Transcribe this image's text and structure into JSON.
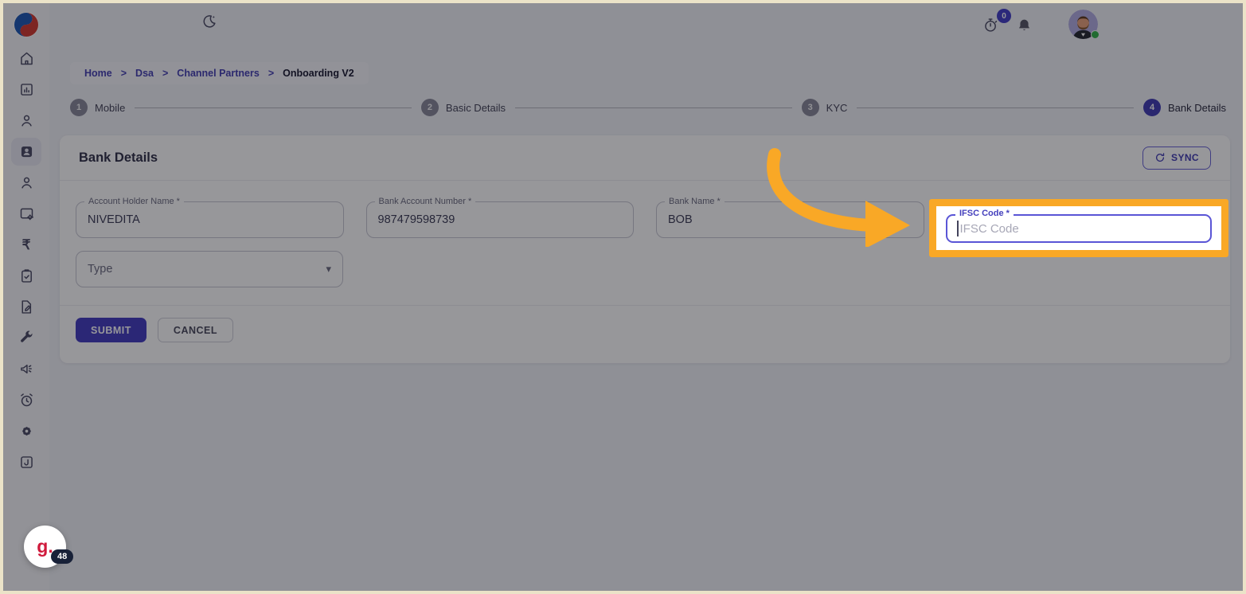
{
  "topbar": {
    "timer_badge": "0"
  },
  "breadcrumb": {
    "separator": ">",
    "items": [
      "Home",
      "Dsa",
      "Channel Partners"
    ],
    "current": "Onboarding V2"
  },
  "stepper": {
    "active_step": "4",
    "steps": [
      {
        "number": "1",
        "label": "Mobile"
      },
      {
        "number": "2",
        "label": "Basic Details"
      },
      {
        "number": "3",
        "label": "KYC"
      },
      {
        "number": "4",
        "label": "Bank Details"
      }
    ]
  },
  "card": {
    "title": "Bank Details",
    "sync_label": "SYNC"
  },
  "form": {
    "account_holder": {
      "label": "Account Holder Name *",
      "value": "NIVEDITA"
    },
    "account_number": {
      "label": "Bank Account Number *",
      "value": "987479598739"
    },
    "bank_name": {
      "label": "Bank Name *",
      "value": "BOB"
    },
    "ifsc": {
      "label": "IFSC Code *",
      "placeholder": "IFSC Code",
      "value": ""
    },
    "type": {
      "placeholder": "Type"
    },
    "submit_label": "SUBMIT",
    "cancel_label": "CANCEL"
  },
  "sidebar": {
    "icons": [
      "home",
      "dashboard",
      "user",
      "id-card",
      "user-group",
      "window-settings",
      "rupee",
      "clipboard-check",
      "file-edit",
      "wrench",
      "megaphone",
      "alarm",
      "settings",
      "journal"
    ],
    "rupee_glyph": "₹"
  },
  "icons": {
    "caret_down": "▾"
  },
  "widget": {
    "logo_text": "g.",
    "badge": "48"
  },
  "colors": {
    "accent": "#443fb5",
    "annotation_orange": "#f9a826",
    "primary_button": "#453ec2",
    "overlay": "rgba(8,8,14,0.42)",
    "status_green": "#35b34a"
  }
}
